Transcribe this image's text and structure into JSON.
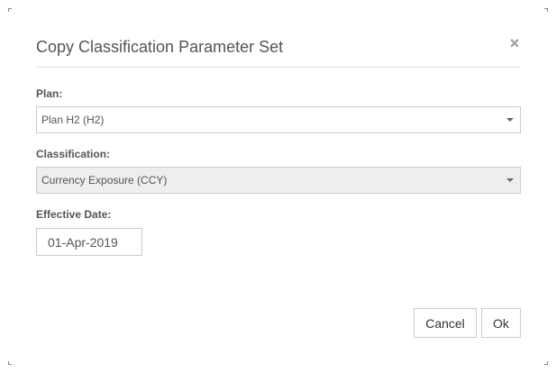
{
  "dialog": {
    "title": "Copy Classification Parameter Set",
    "close_symbol": "×"
  },
  "plan": {
    "label": "Plan:",
    "selected": "Plan H2 (H2)"
  },
  "classification": {
    "label": "Classification:",
    "selected": "Currency Exposure (CCY)",
    "disabled": true
  },
  "effective_date": {
    "label": "Effective Date:",
    "value": "01-Apr-2019"
  },
  "buttons": {
    "cancel_label": "Cancel",
    "ok_label": "Ok"
  },
  "icons": {
    "close": "close-icon",
    "dropdown": "chevron-down-icon"
  }
}
